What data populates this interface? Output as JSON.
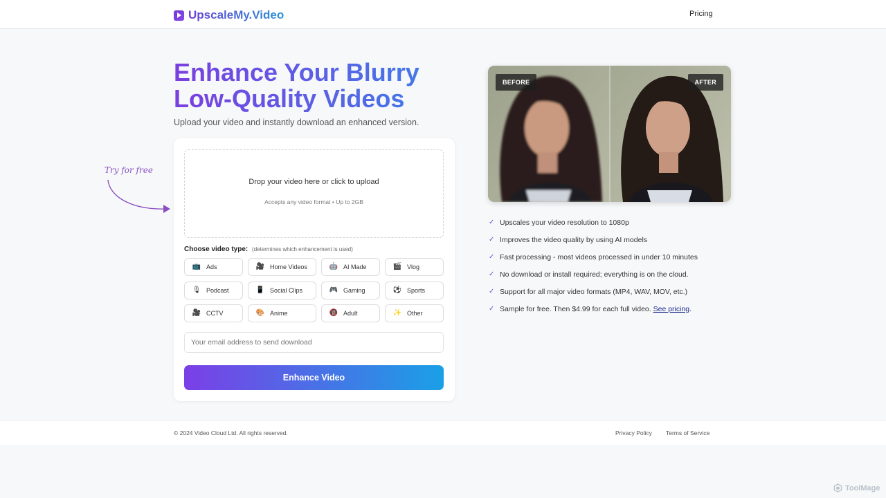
{
  "header": {
    "logo_text": "UpscaleMy.Video",
    "nav_pricing": "Pricing"
  },
  "hero": {
    "title_line1": "Enhance Your Blurry",
    "title_line2": "Low-Quality Videos",
    "subtitle": "Upload your video and instantly download an enhanced version."
  },
  "annotation": {
    "try_free": "Try for free"
  },
  "upload": {
    "main_text": "Drop your video here or click to upload",
    "note": "Accepts any video format • Up to 2GB"
  },
  "video_type": {
    "label": "Choose video type:",
    "note": "(determines which enhancement is used)",
    "options": [
      {
        "label": "Ads",
        "icon": "tv-icon"
      },
      {
        "label": "Home Videos",
        "icon": "camera-icon"
      },
      {
        "label": "AI Made",
        "icon": "robot-icon"
      },
      {
        "label": "Vlog",
        "icon": "clapper-icon"
      },
      {
        "label": "Podcast",
        "icon": "microphone-icon"
      },
      {
        "label": "Social Clips",
        "icon": "phone-icon"
      },
      {
        "label": "Gaming",
        "icon": "gamepad-icon"
      },
      {
        "label": "Sports",
        "icon": "soccer-ball-icon"
      },
      {
        "label": "CCTV",
        "icon": "camera-icon"
      },
      {
        "label": "Anime",
        "icon": "palette-icon"
      },
      {
        "label": "Adult",
        "icon": "eighteen-icon"
      },
      {
        "label": "Other",
        "icon": "sparkles-icon"
      }
    ]
  },
  "form": {
    "email_placeholder": "Your email address to send download",
    "email_value": "",
    "submit_label": "Enhance Video"
  },
  "compare": {
    "before_label": "BEFORE",
    "after_label": "AFTER"
  },
  "features": [
    {
      "text": "Upscales your video resolution to 1080p"
    },
    {
      "text": "Improves the video quality by using AI models"
    },
    {
      "text": "Fast processing - most videos processed in under 10 minutes"
    },
    {
      "text": "No download or install required; everything is on the cloud."
    },
    {
      "text": "Support for all major video formats (MP4, WAV, MOV, etc.)"
    },
    {
      "text": "Sample for free. Then $4.99 for each full video.",
      "link": "See pricing",
      "suffix": "."
    }
  ],
  "footer": {
    "copyright": "© 2024 Video Cloud Ltd. All rights reserved.",
    "privacy": "Privacy Policy",
    "terms": "Terms of Service"
  },
  "watermark": {
    "text": "ToolMage"
  },
  "colors": {
    "accent_purple": "#7b3fe6",
    "accent_blue": "#1aa0e6",
    "check_color": "#7b4fd0"
  }
}
